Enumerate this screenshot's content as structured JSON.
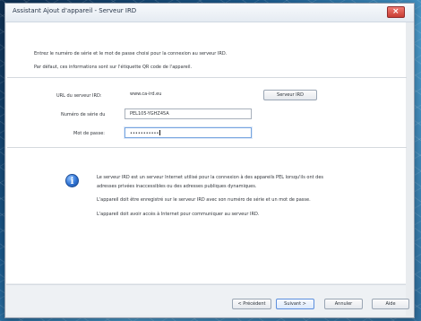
{
  "window": {
    "title": "Assistant Ajout d'appareil - Serveur IRD",
    "close_symbol": "×"
  },
  "intro": {
    "line1": "Entrez le numéro de série et le mot de passe choisi pour la connexion au serveur IRD.",
    "line2": "Par défaut, ces informations sont sur l'étiquette QR code de l'appareil."
  },
  "fields": {
    "url_label": "URL du serveur IRD:",
    "url_value": "www.ca-ird.eu",
    "serial_label": "Numéro de série du",
    "serial_value": "PEL105-YGHZ45A",
    "password_label": "Mot de passe:",
    "password_value": "•••••••••••"
  },
  "buttons": {
    "server_ird": "Serveur IRD",
    "previous": "< Précédent",
    "next": "Suivant >",
    "cancel": "Annuler",
    "help": "Aide"
  },
  "info": {
    "paragraph1_line1": "Le serveur IRD est un serveur Internet utilisé pour la connexion à des appareils PEL lorsqu'ils ont des",
    "paragraph1_line2": "adresses privées inaccessibles ou des adresses publiques dynamiques.",
    "paragraph2": "L'appareil doit être enregistré sur le serveur IRD avec son numéro de série et un mot de passe.",
    "paragraph3": "L'appareil doit avoir accès à Internet pour communiquer au serveur IRD."
  }
}
